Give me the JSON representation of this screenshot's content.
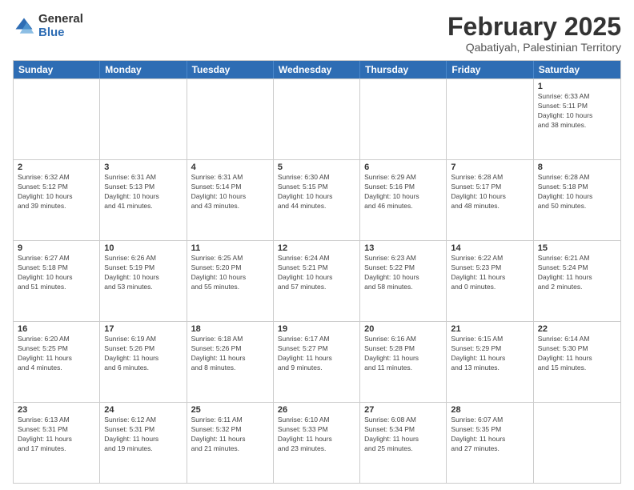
{
  "logo": {
    "general": "General",
    "blue": "Blue"
  },
  "title": "February 2025",
  "subtitle": "Qabatiyah, Palestinian Territory",
  "header_days": [
    "Sunday",
    "Monday",
    "Tuesday",
    "Wednesday",
    "Thursday",
    "Friday",
    "Saturday"
  ],
  "weeks": [
    [
      {
        "day": "",
        "info": ""
      },
      {
        "day": "",
        "info": ""
      },
      {
        "day": "",
        "info": ""
      },
      {
        "day": "",
        "info": ""
      },
      {
        "day": "",
        "info": ""
      },
      {
        "day": "",
        "info": ""
      },
      {
        "day": "1",
        "info": "Sunrise: 6:33 AM\nSunset: 5:11 PM\nDaylight: 10 hours\nand 38 minutes."
      }
    ],
    [
      {
        "day": "2",
        "info": "Sunrise: 6:32 AM\nSunset: 5:12 PM\nDaylight: 10 hours\nand 39 minutes."
      },
      {
        "day": "3",
        "info": "Sunrise: 6:31 AM\nSunset: 5:13 PM\nDaylight: 10 hours\nand 41 minutes."
      },
      {
        "day": "4",
        "info": "Sunrise: 6:31 AM\nSunset: 5:14 PM\nDaylight: 10 hours\nand 43 minutes."
      },
      {
        "day": "5",
        "info": "Sunrise: 6:30 AM\nSunset: 5:15 PM\nDaylight: 10 hours\nand 44 minutes."
      },
      {
        "day": "6",
        "info": "Sunrise: 6:29 AM\nSunset: 5:16 PM\nDaylight: 10 hours\nand 46 minutes."
      },
      {
        "day": "7",
        "info": "Sunrise: 6:28 AM\nSunset: 5:17 PM\nDaylight: 10 hours\nand 48 minutes."
      },
      {
        "day": "8",
        "info": "Sunrise: 6:28 AM\nSunset: 5:18 PM\nDaylight: 10 hours\nand 50 minutes."
      }
    ],
    [
      {
        "day": "9",
        "info": "Sunrise: 6:27 AM\nSunset: 5:18 PM\nDaylight: 10 hours\nand 51 minutes."
      },
      {
        "day": "10",
        "info": "Sunrise: 6:26 AM\nSunset: 5:19 PM\nDaylight: 10 hours\nand 53 minutes."
      },
      {
        "day": "11",
        "info": "Sunrise: 6:25 AM\nSunset: 5:20 PM\nDaylight: 10 hours\nand 55 minutes."
      },
      {
        "day": "12",
        "info": "Sunrise: 6:24 AM\nSunset: 5:21 PM\nDaylight: 10 hours\nand 57 minutes."
      },
      {
        "day": "13",
        "info": "Sunrise: 6:23 AM\nSunset: 5:22 PM\nDaylight: 10 hours\nand 58 minutes."
      },
      {
        "day": "14",
        "info": "Sunrise: 6:22 AM\nSunset: 5:23 PM\nDaylight: 11 hours\nand 0 minutes."
      },
      {
        "day": "15",
        "info": "Sunrise: 6:21 AM\nSunset: 5:24 PM\nDaylight: 11 hours\nand 2 minutes."
      }
    ],
    [
      {
        "day": "16",
        "info": "Sunrise: 6:20 AM\nSunset: 5:25 PM\nDaylight: 11 hours\nand 4 minutes."
      },
      {
        "day": "17",
        "info": "Sunrise: 6:19 AM\nSunset: 5:26 PM\nDaylight: 11 hours\nand 6 minutes."
      },
      {
        "day": "18",
        "info": "Sunrise: 6:18 AM\nSunset: 5:26 PM\nDaylight: 11 hours\nand 8 minutes."
      },
      {
        "day": "19",
        "info": "Sunrise: 6:17 AM\nSunset: 5:27 PM\nDaylight: 11 hours\nand 9 minutes."
      },
      {
        "day": "20",
        "info": "Sunrise: 6:16 AM\nSunset: 5:28 PM\nDaylight: 11 hours\nand 11 minutes."
      },
      {
        "day": "21",
        "info": "Sunrise: 6:15 AM\nSunset: 5:29 PM\nDaylight: 11 hours\nand 13 minutes."
      },
      {
        "day": "22",
        "info": "Sunrise: 6:14 AM\nSunset: 5:30 PM\nDaylight: 11 hours\nand 15 minutes."
      }
    ],
    [
      {
        "day": "23",
        "info": "Sunrise: 6:13 AM\nSunset: 5:31 PM\nDaylight: 11 hours\nand 17 minutes."
      },
      {
        "day": "24",
        "info": "Sunrise: 6:12 AM\nSunset: 5:31 PM\nDaylight: 11 hours\nand 19 minutes."
      },
      {
        "day": "25",
        "info": "Sunrise: 6:11 AM\nSunset: 5:32 PM\nDaylight: 11 hours\nand 21 minutes."
      },
      {
        "day": "26",
        "info": "Sunrise: 6:10 AM\nSunset: 5:33 PM\nDaylight: 11 hours\nand 23 minutes."
      },
      {
        "day": "27",
        "info": "Sunrise: 6:08 AM\nSunset: 5:34 PM\nDaylight: 11 hours\nand 25 minutes."
      },
      {
        "day": "28",
        "info": "Sunrise: 6:07 AM\nSunset: 5:35 PM\nDaylight: 11 hours\nand 27 minutes."
      },
      {
        "day": "",
        "info": ""
      }
    ]
  ]
}
